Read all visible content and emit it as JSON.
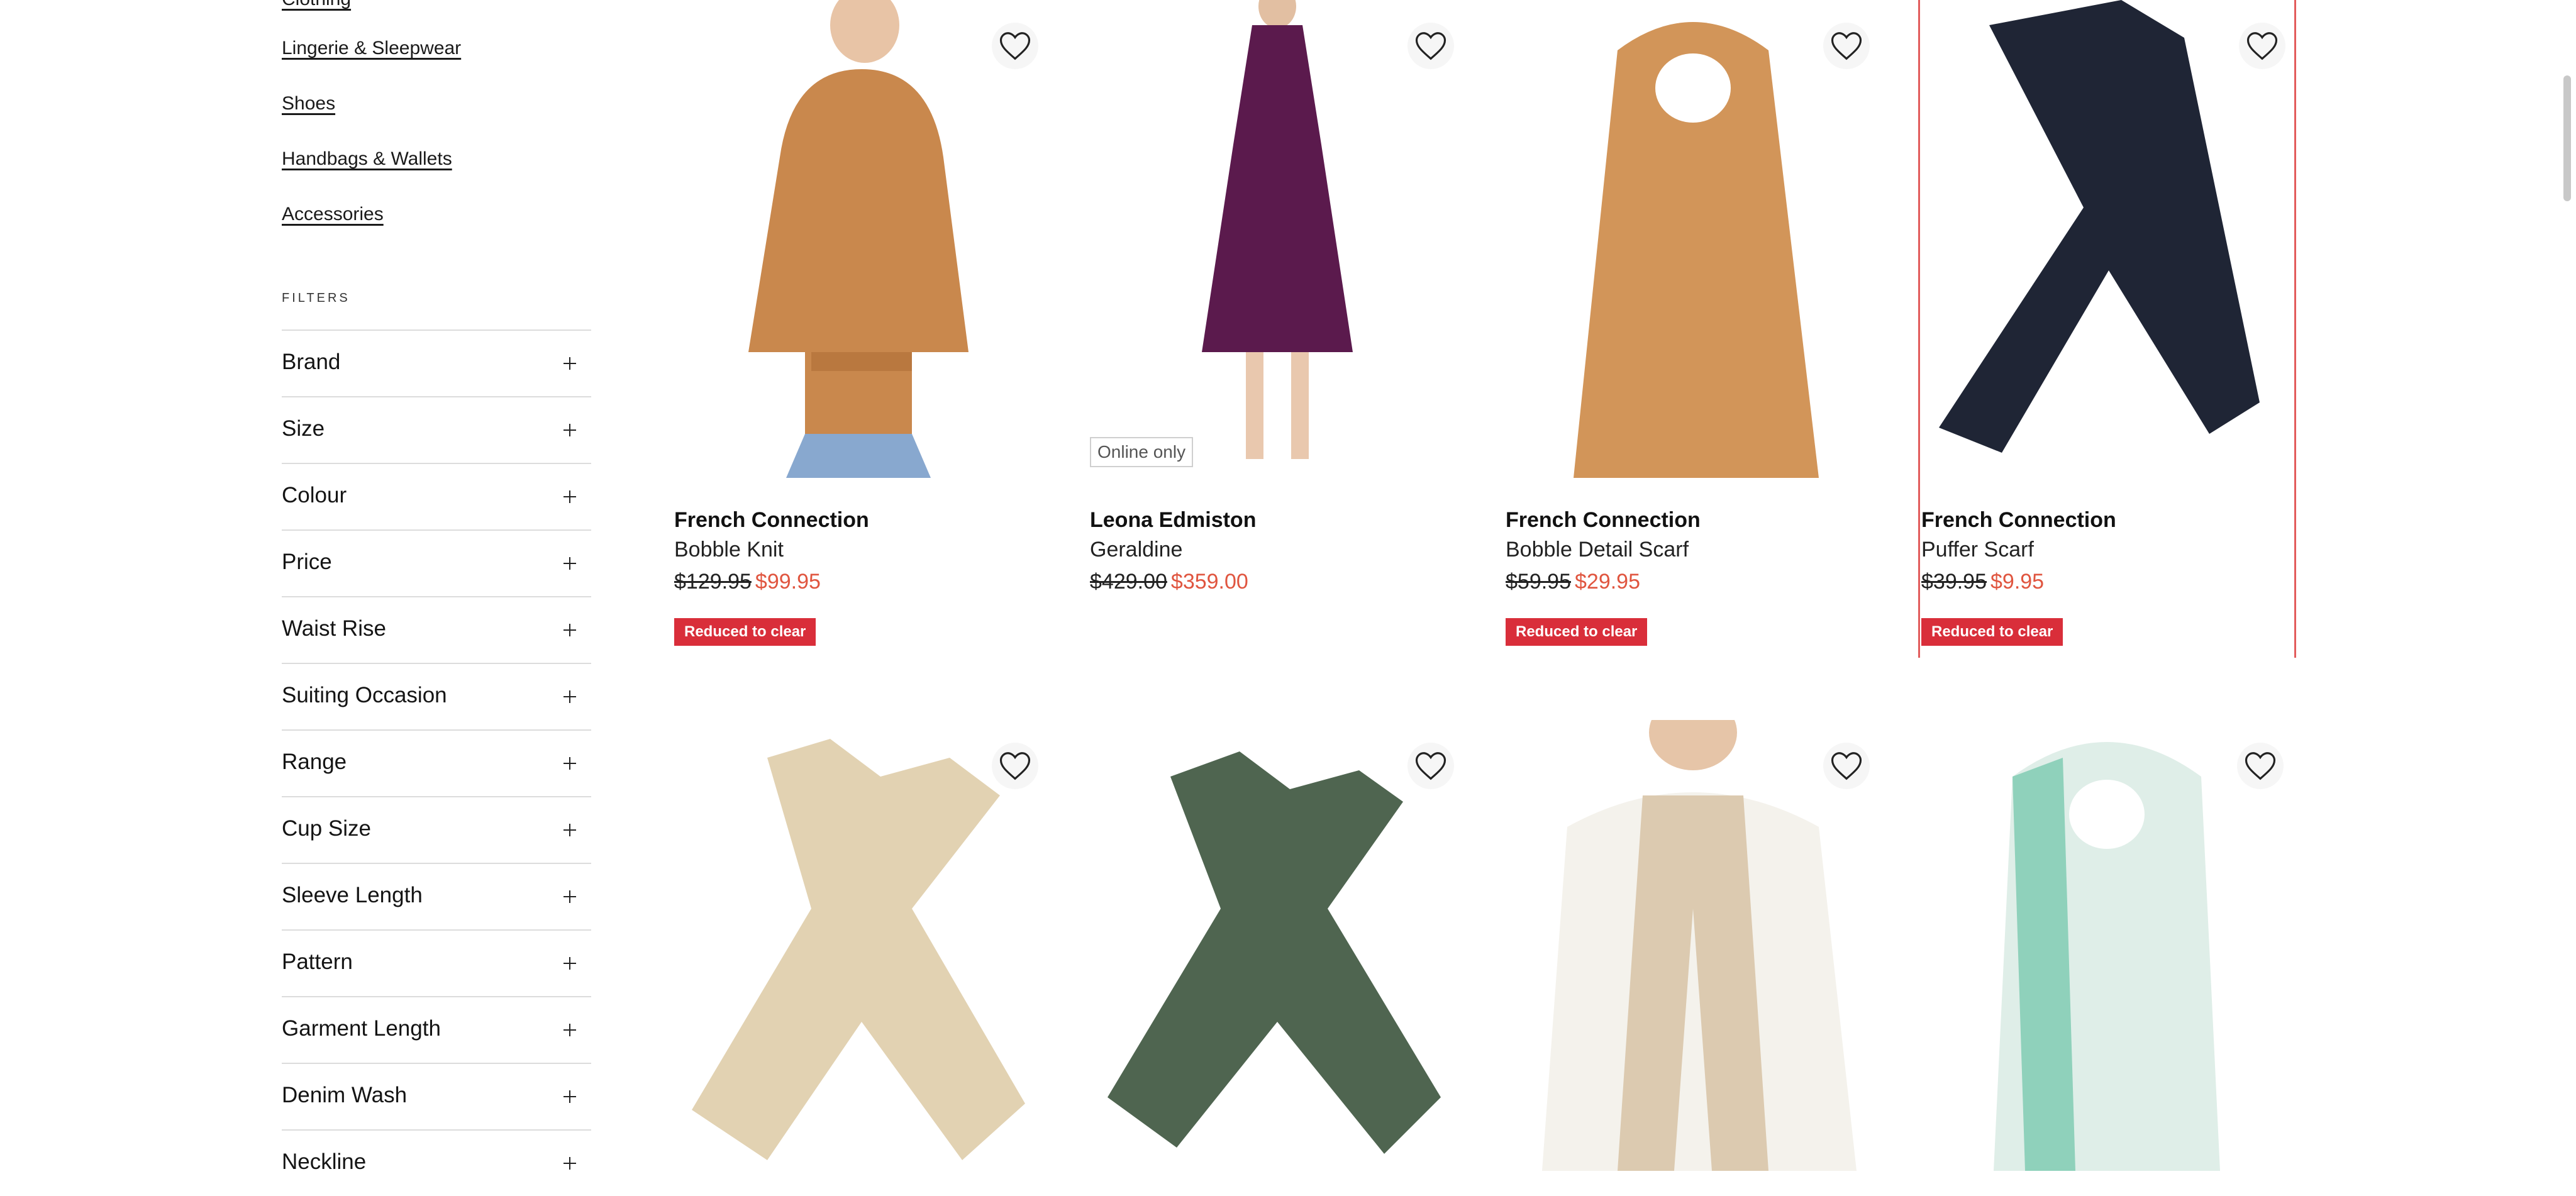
{
  "categories": [
    {
      "label": "Clothing"
    },
    {
      "label": "Lingerie & Sleepwear"
    },
    {
      "label": "Shoes"
    },
    {
      "label": "Handbags & Wallets"
    },
    {
      "label": "Accessories"
    }
  ],
  "filters": {
    "heading": "FILTERS",
    "items": [
      {
        "label": "Brand"
      },
      {
        "label": "Size"
      },
      {
        "label": "Colour"
      },
      {
        "label": "Price"
      },
      {
        "label": "Waist Rise"
      },
      {
        "label": "Suiting Occasion"
      },
      {
        "label": "Range"
      },
      {
        "label": "Cup Size"
      },
      {
        "label": "Sleeve Length"
      },
      {
        "label": "Pattern"
      },
      {
        "label": "Garment Length"
      },
      {
        "label": "Denim Wash"
      },
      {
        "label": "Neckline"
      }
    ]
  },
  "products": [
    {
      "brand": "French Connection",
      "name": "Bobble Knit",
      "was_price": "$129.95",
      "now_price": "$99.95",
      "badge": "Reduced to clear"
    },
    {
      "brand": "Leona Edmiston",
      "name": "Geraldine",
      "was_price": "$429.00",
      "now_price": "$359.00",
      "tag": "Online only"
    },
    {
      "brand": "French Connection",
      "name": "Bobble Detail Scarf",
      "was_price": "$59.95",
      "now_price": "$29.95",
      "badge": "Reduced to clear"
    },
    {
      "brand": "French Connection",
      "name": "Puffer Scarf",
      "was_price": "$39.95",
      "now_price": "$9.95",
      "badge": "Reduced to clear"
    }
  ],
  "colors": {
    "sale_price": "#e0553f",
    "badge_bg": "#d92e3a",
    "highlight_border": "#e25c5c"
  }
}
